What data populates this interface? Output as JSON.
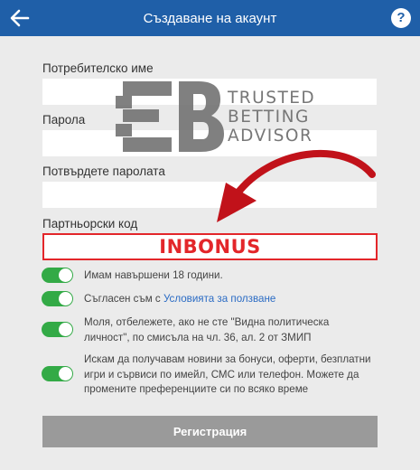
{
  "header": {
    "title": "Създаване на акаунт",
    "help_label": "?"
  },
  "form": {
    "username_label": "Потребителско име",
    "password_label": "Парола",
    "confirm_label": "Потвърдете паролата",
    "partner_label": "Партньорски код",
    "partner_value": "INBONUS"
  },
  "options": [
    {
      "text": "Имам навършени 18 години.",
      "on": true
    },
    {
      "text_before": "Съгласен съм с ",
      "link": "Условията за ползване",
      "on": true
    },
    {
      "text": "Моля, отбележете, ако не сте \"Видна политическа личност\", по смисъла на чл. 36, ал. 2 от ЗМИП",
      "on": true
    },
    {
      "text": "Искам да получавам новини за бонуси, оферти, безплатни игри и сървиси по имейл, СМС или телефон. Можете да промените преференциите си по всяко време",
      "on": true
    }
  ],
  "submit_label": "Регистрация",
  "watermark": {
    "line1": "TRUSTED",
    "line2": "BETTING",
    "line3": "ADVISOR"
  },
  "colors": {
    "appbar": "#1f5fa8",
    "toggle_on": "#33aa46",
    "highlight_red": "#e3262a",
    "link": "#2a6bc4",
    "button_disabled": "#9a9a9a"
  }
}
